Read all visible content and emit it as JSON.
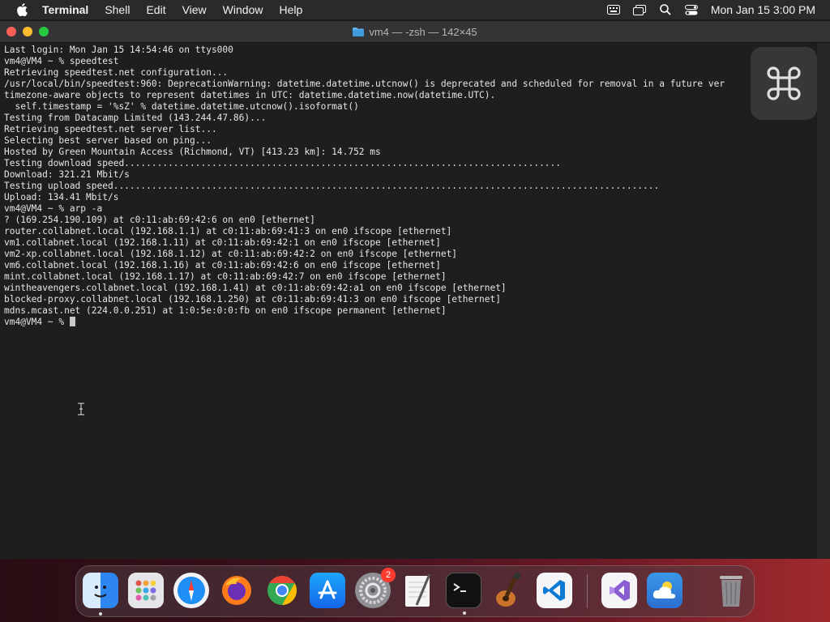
{
  "menubar": {
    "app_name": "Terminal",
    "items": [
      "Shell",
      "Edit",
      "View",
      "Window",
      "Help"
    ],
    "clock": "Mon Jan 15  3:00 PM"
  },
  "window": {
    "title": "vm4 — -zsh — 142×45"
  },
  "terminal": {
    "lines": [
      "Last login: Mon Jan 15 14:54:46 on ttys000",
      "vm4@VM4 ~ % speedtest",
      "Retrieving speedtest.net configuration...",
      "/usr/local/bin/speedtest:960: DeprecationWarning: datetime.datetime.utcnow() is deprecated and scheduled for removal in a future ver",
      "timezone-aware objects to represent datetimes in UTC: datetime.datetime.now(datetime.UTC).",
      "  self.timestamp = '%sZ' % datetime.datetime.utcnow().isoformat()",
      "Testing from Datacamp Limited (143.244.47.86)...",
      "Retrieving speedtest.net server list...",
      "Selecting best server based on ping...",
      "Hosted by Green Mountain Access (Richmond, VT) [413.23 km]: 14.752 ms",
      "Testing download speed................................................................................",
      "Download: 321.21 Mbit/s",
      "Testing upload speed....................................................................................................",
      "Upload: 134.41 Mbit/s",
      "vm4@VM4 ~ % arp -a",
      "? (169.254.190.109) at c0:11:ab:69:42:6 on en0 [ethernet]",
      "router.collabnet.local (192.168.1.1) at c0:11:ab:69:41:3 on en0 ifscope [ethernet]",
      "vm1.collabnet.local (192.168.1.11) at c0:11:ab:69:42:1 on en0 ifscope [ethernet]",
      "vm2-xp.collabnet.local (192.168.1.12) at c0:11:ab:69:42:2 on en0 ifscope [ethernet]",
      "vm6.collabnet.local (192.168.1.16) at c0:11:ab:69:42:6 on en0 ifscope [ethernet]",
      "mint.collabnet.local (192.168.1.17) at c0:11:ab:69:42:7 on en0 ifscope [ethernet]",
      "wintheavengers.collabnet.local (192.168.1.41) at c0:11:ab:69:42:a1 on en0 ifscope [ethernet]",
      "blocked-proxy.collabnet.local (192.168.1.250) at c0:11:ab:69:41:3 on en0 ifscope [ethernet]",
      "mdns.mcast.net (224.0.0.251) at 1:0:5e:0:0:fb on en0 ifscope permanent [ethernet]"
    ],
    "prompt": "vm4@VM4 ~ % "
  },
  "dock": {
    "items": [
      {
        "name": "finder-icon",
        "color": "#3b8ef0"
      },
      {
        "name": "launchpad-icon",
        "color": "#d9d9de"
      },
      {
        "name": "safari-icon",
        "color": "#2a8cf0"
      },
      {
        "name": "firefox-icon",
        "color": "#ff7a1a"
      },
      {
        "name": "chrome-icon",
        "color": "#34a853"
      },
      {
        "name": "app-store-icon",
        "color": "#1e8ff5"
      },
      {
        "name": "system-settings-icon",
        "color": "#8e8e93",
        "badge": "2"
      },
      {
        "name": "textedit-icon",
        "color": "#f2f2f2"
      },
      {
        "name": "terminal-icon",
        "color": "#1e1e1e"
      },
      {
        "name": "garageband-icon",
        "color": "#c9742a"
      },
      {
        "name": "vscode-icon",
        "color": "#0d7bd4"
      },
      {
        "name": "visual-studio-icon",
        "color": "#8a5dd3"
      },
      {
        "name": "weather-icon",
        "color": "#3d8fe0"
      },
      {
        "name": "trash-icon",
        "color": "#9a9a9a"
      }
    ]
  }
}
